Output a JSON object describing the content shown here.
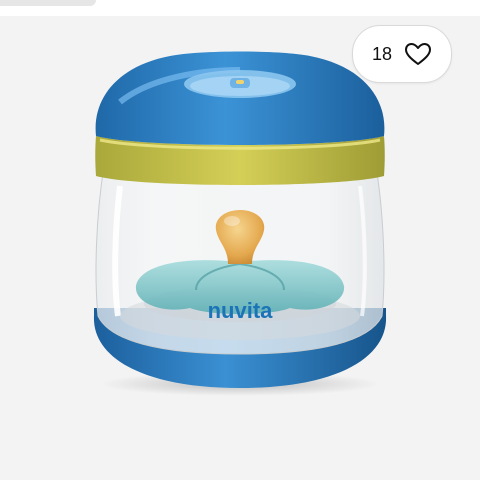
{
  "likes": {
    "count": "18",
    "icon": "heart-outline-icon"
  },
  "product": {
    "brand_text": "nuvita"
  },
  "colors": {
    "background": "#f3f3f3",
    "cap_blue": "#2f86c9",
    "band_yellow": "#c8c44a",
    "base_blue": "#2d7fc2",
    "nipple_amber": "#e8b25a",
    "shield_teal": "#7ec6c9"
  }
}
